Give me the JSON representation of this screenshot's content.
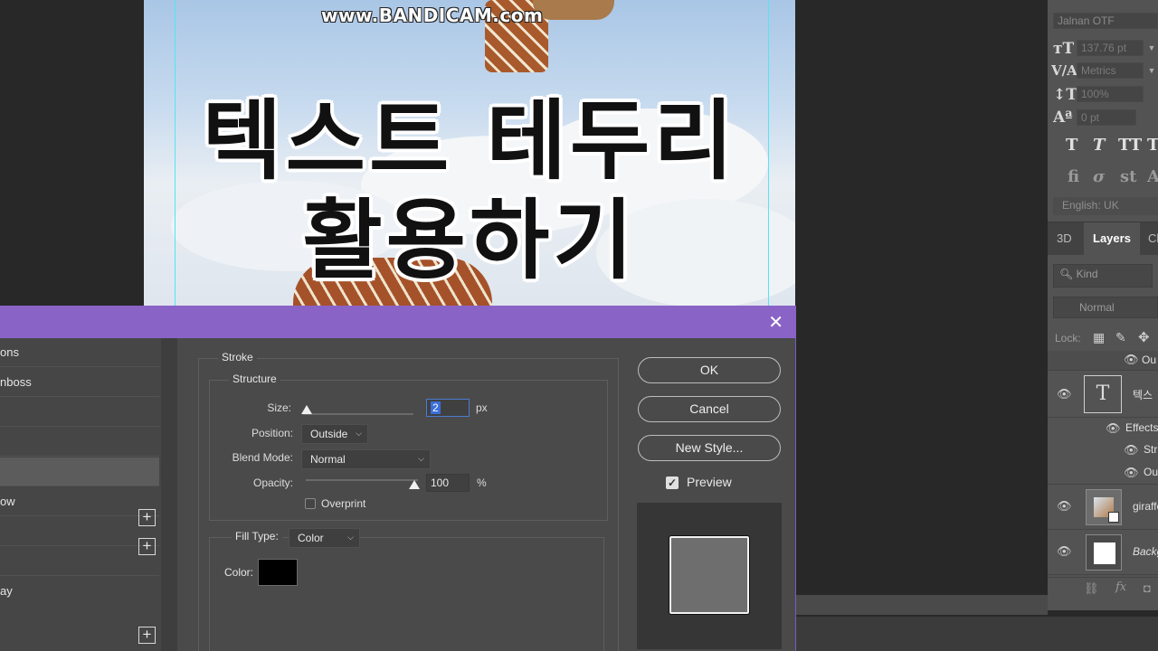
{
  "watermark": "www.BANDICAM.com",
  "canvas": {
    "line1": "텍스트 테두리",
    "line2": "활용하기"
  },
  "character_panel": {
    "font_name": "Jalnan OTF",
    "font_size": "137.76 pt",
    "kerning": "Metrics",
    "vertical_scale": "100%",
    "baseline_shift": "0 pt",
    "language": "English: UK",
    "icons": [
      "font-size-icon",
      "kerning-icon",
      "vertical-scale-icon",
      "baseline-shift-icon"
    ]
  },
  "layers_panel": {
    "tabs": [
      "3D",
      "Layers",
      "Ch"
    ],
    "active_tab": "Layers",
    "search_placeholder": "Kind",
    "blend_mode": "Normal",
    "lock_label": "Lock:",
    "layers": [
      {
        "name": "Ou",
        "type": "effect"
      },
      {
        "name": "텍스",
        "type": "text"
      },
      {
        "name": "Effects",
        "type": "effects-header"
      },
      {
        "name": "Str",
        "type": "effect"
      },
      {
        "name": "Ou",
        "type": "effect"
      },
      {
        "name": "giraffe",
        "type": "smart-object"
      },
      {
        "name": "Backg",
        "type": "background"
      }
    ]
  },
  "dialog": {
    "left_list": [
      {
        "label": "ons",
        "has_plus": false
      },
      {
        "label": "nboss",
        "has_plus": false
      },
      {
        "label": "",
        "has_plus": false
      },
      {
        "label": "",
        "has_plus": false
      },
      {
        "label": "",
        "has_plus": true,
        "selected": true
      },
      {
        "label": "ow",
        "has_plus": true
      },
      {
        "label": "",
        "has_plus": false
      },
      {
        "label": "",
        "has_plus": false
      },
      {
        "label": "ay",
        "has_plus": true
      }
    ],
    "stroke_title": "Stroke",
    "structure_title": "Structure",
    "size_label": "Size:",
    "size_value": "2",
    "size_unit": "px",
    "size_fraction": 0.0,
    "position_label": "Position:",
    "position_value": "Outside",
    "blend_mode_label": "Blend Mode:",
    "blend_mode_value": "Normal",
    "opacity_label": "Opacity:",
    "opacity_value": "100",
    "opacity_unit": "%",
    "opacity_fraction": 1.0,
    "overprint_label": "Overprint",
    "overprint_checked": false,
    "fill_type_label": "Fill Type:",
    "fill_type_value": "Color",
    "color_label": "Color:",
    "color_value": "#000000",
    "buttons": {
      "ok": "OK",
      "cancel": "Cancel",
      "new_style": "New Style..."
    },
    "preview_label": "Preview",
    "preview_checked": true,
    "title_bar_color": "#8a63c6"
  }
}
